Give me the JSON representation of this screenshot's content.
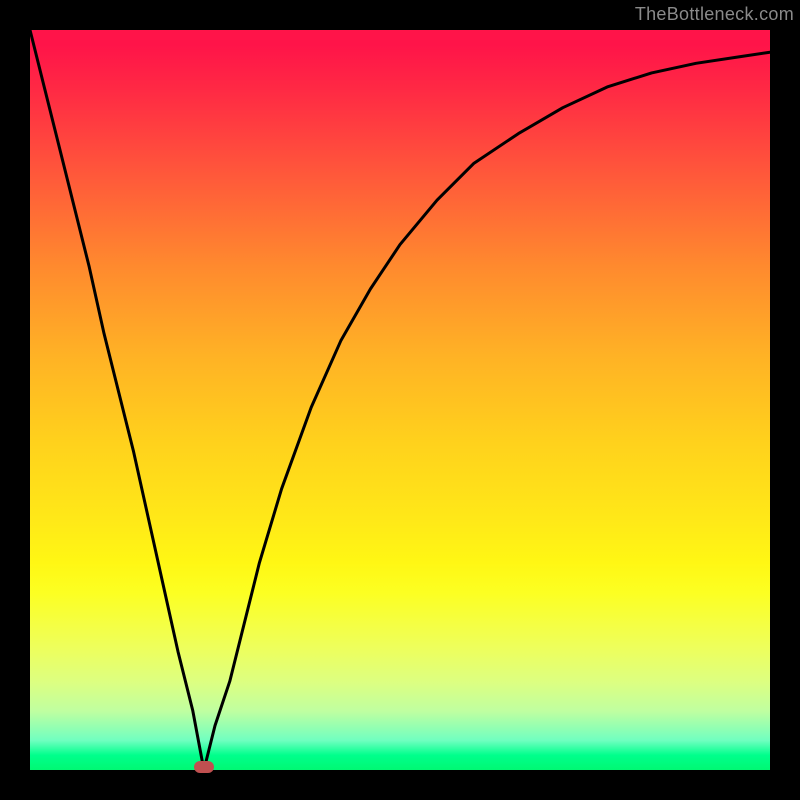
{
  "watermark": "TheBottleneck.com",
  "chart_data": {
    "type": "line",
    "title": "",
    "xlabel": "",
    "ylabel": "",
    "xlim": [
      0,
      100
    ],
    "ylim": [
      0,
      100
    ],
    "grid": false,
    "legend": false,
    "background": "red-yellow-green vertical gradient (top=red, bottom=green)",
    "series": [
      {
        "name": "curve",
        "x": [
          0,
          2,
          4,
          6,
          8,
          10,
          12,
          14,
          16,
          18,
          20,
          22,
          23.5,
          25,
          27,
          29,
          31,
          34,
          38,
          42,
          46,
          50,
          55,
          60,
          66,
          72,
          78,
          84,
          90,
          96,
          100
        ],
        "y": [
          100,
          92,
          84,
          76,
          68,
          59,
          51,
          43,
          34,
          25,
          16,
          8,
          0,
          6,
          12,
          20,
          28,
          38,
          49,
          58,
          65,
          71,
          77,
          82,
          86,
          89.5,
          92.3,
          94.2,
          95.5,
          96.4,
          97
        ]
      }
    ],
    "marker": {
      "x": 23.5,
      "y": 0,
      "color": "#c05050"
    }
  }
}
